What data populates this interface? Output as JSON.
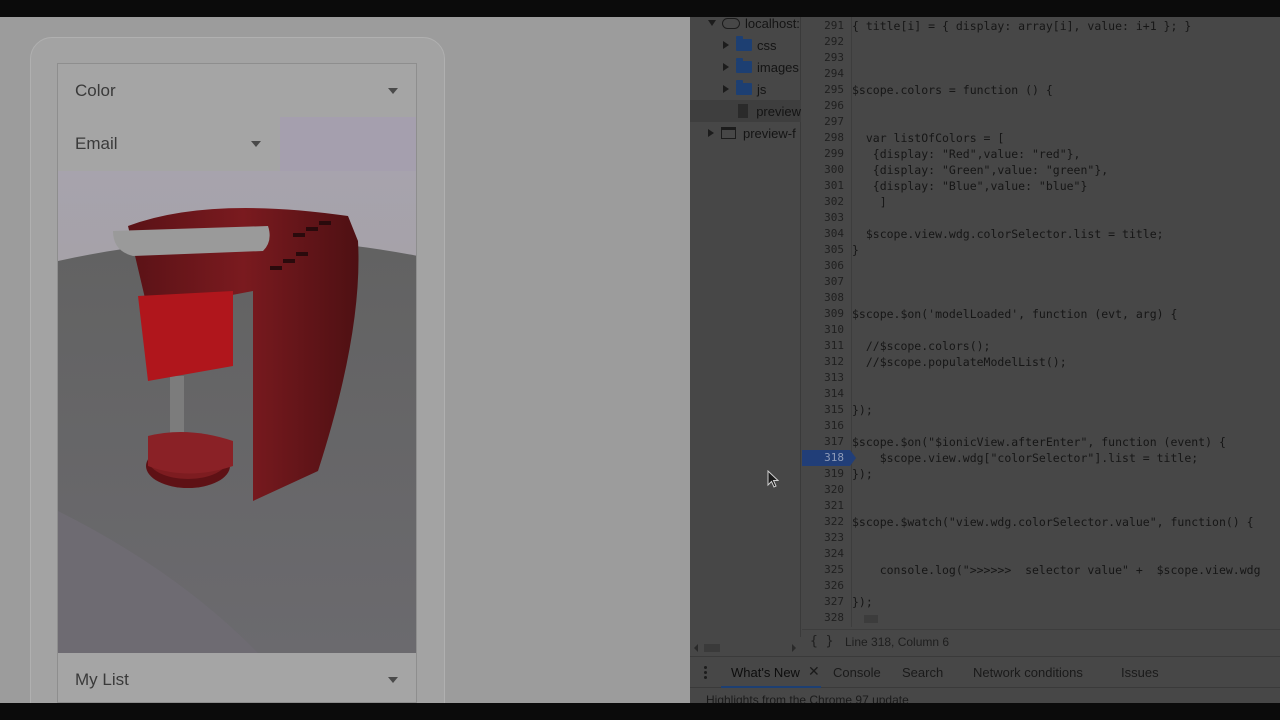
{
  "preview": {
    "select_color": "Color",
    "select_email": "Email",
    "select_list": "My List",
    "model_alt": "red coffee maker 3D model"
  },
  "devtools": {
    "tree": {
      "root": "localhost:",
      "folders": [
        "css",
        "images",
        "js"
      ],
      "file": "preview",
      "frame": "preview-f"
    },
    "lines": [
      {
        "n": "291",
        "code": "{ title[i] = { display: array[i], value: i+1 }; }"
      },
      {
        "n": "292",
        "code": ""
      },
      {
        "n": "293",
        "code": ""
      },
      {
        "n": "294",
        "code": ""
      },
      {
        "n": "295",
        "code": "$scope.colors = function () {"
      },
      {
        "n": "296",
        "code": ""
      },
      {
        "n": "297",
        "code": ""
      },
      {
        "n": "298",
        "code": "  var listOfColors = ["
      },
      {
        "n": "299",
        "code": "   {display: \"Red\",value: \"red\"},"
      },
      {
        "n": "300",
        "code": "   {display: \"Green\",value: \"green\"},"
      },
      {
        "n": "301",
        "code": "   {display: \"Blue\",value: \"blue\"}"
      },
      {
        "n": "302",
        "code": "    ]"
      },
      {
        "n": "303",
        "code": ""
      },
      {
        "n": "304",
        "code": "  $scope.view.wdg.colorSelector.list = title;"
      },
      {
        "n": "305",
        "code": "}"
      },
      {
        "n": "306",
        "code": ""
      },
      {
        "n": "307",
        "code": ""
      },
      {
        "n": "308",
        "code": ""
      },
      {
        "n": "309",
        "code": "$scope.$on('modelLoaded', function (evt, arg) {"
      },
      {
        "n": "310",
        "code": ""
      },
      {
        "n": "311",
        "code": "  //$scope.colors();"
      },
      {
        "n": "312",
        "code": "  //$scope.populateModelList();"
      },
      {
        "n": "313",
        "code": ""
      },
      {
        "n": "314",
        "code": ""
      },
      {
        "n": "315",
        "code": "});"
      },
      {
        "n": "316",
        "code": ""
      },
      {
        "n": "317",
        "code": "$scope.$on(\"$ionicView.afterEnter\", function (event) {"
      },
      {
        "n": "318",
        "code": "    $scope.view.wdg[\"colorSelector\"].list = title;"
      },
      {
        "n": "319",
        "code": "});"
      },
      {
        "n": "320",
        "code": ""
      },
      {
        "n": "321",
        "code": ""
      },
      {
        "n": "322",
        "code": "$scope.$watch(\"view.wdg.colorSelector.value\", function() {"
      },
      {
        "n": "323",
        "code": ""
      },
      {
        "n": "324",
        "code": ""
      },
      {
        "n": "325",
        "code": "    console.log(\">>>>>>  selector value\" +  $scope.view.wdg"
      },
      {
        "n": "326",
        "code": ""
      },
      {
        "n": "327",
        "code": "});"
      },
      {
        "n": "328",
        "code": ""
      }
    ],
    "active_line": "318",
    "status": {
      "braces": "{ }",
      "position": "Line 318, Column 6"
    },
    "drawer": {
      "tabs": [
        "What's New",
        "Console",
        "Search",
        "Network conditions",
        "Issues"
      ],
      "body": "Highlights from the Chrome 97 update"
    }
  },
  "colors": {
    "accent": "#1d3f72",
    "active_line": "#213e78",
    "model_red": "#7a1a1f"
  }
}
